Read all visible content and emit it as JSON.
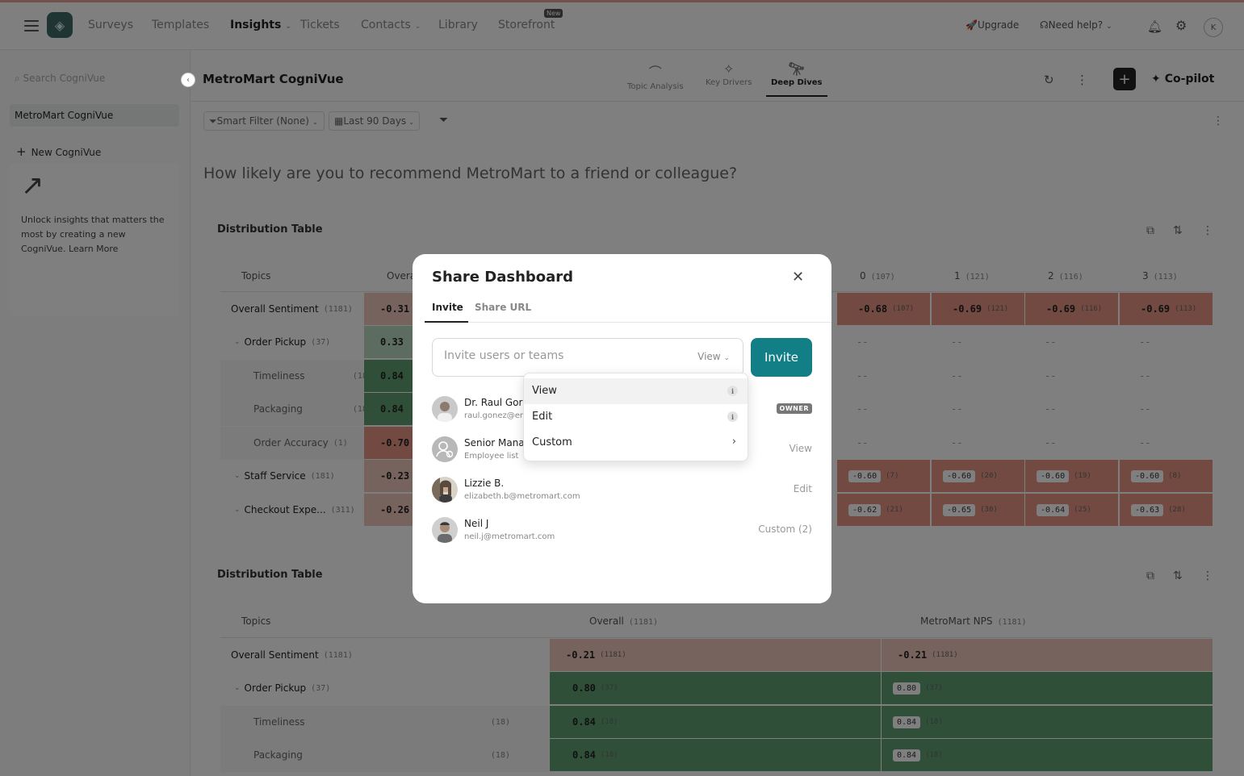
{
  "nav": {
    "items": [
      "Surveys",
      "Templates",
      "Insights",
      "Tickets",
      "Contacts",
      "Library",
      "Storefront"
    ],
    "new_badge": "New",
    "upgrade": "Upgrade",
    "help": "Need help?",
    "avatar_initial": "K"
  },
  "sidebar": {
    "search_placeholder": "Search CogniVue",
    "active_item": "MetroMart CogniVue",
    "new_item": "New CogniVue",
    "promo_text": "Unlock insights that matters the most by creating a new CogniVue.",
    "promo_link": "Learn More"
  },
  "header": {
    "title": "MetroMart CogniVue",
    "tabs": [
      "Topic Analysis",
      "Key Drivers",
      "Deep Dives"
    ],
    "active_tab": "Deep Dives",
    "copilot": "Co-pilot"
  },
  "filters": {
    "smart_filter": "Smart Filter (None)",
    "date_range": "Last 90 Days"
  },
  "question": "How likely are you to recommend MetroMart to a friend or colleague?",
  "table1": {
    "title": "Distribution Table",
    "col_topics": "Topics",
    "col_overall": "Overa",
    "score_cols": [
      {
        "label": "0",
        "count": "(107)"
      },
      {
        "label": "1",
        "count": "(121)"
      },
      {
        "label": "2",
        "count": "(116)"
      },
      {
        "label": "3",
        "count": "(113)"
      }
    ],
    "rows": [
      {
        "label": "Overall Sentiment",
        "count": "(1181)",
        "overall": "-0.31",
        "cells": [
          "-0.68",
          "-0.69",
          "-0.69",
          "-0.69"
        ],
        "subs": [
          "(107)",
          "(121)",
          "(116)",
          "(113)"
        ]
      },
      {
        "label": "Order Pickup",
        "count": "(37)",
        "overall": "0.33",
        "cells": [
          "--",
          "--",
          "--",
          "--"
        ],
        "subs": [
          "",
          "",
          "",
          ""
        ]
      },
      {
        "label": "Timeliness",
        "count": "(18)",
        "overall": "0.84",
        "cells": [
          "--",
          "--",
          "--",
          "--"
        ],
        "subs": [
          "",
          "",
          "",
          ""
        ]
      },
      {
        "label": "Packaging",
        "count": "(18)",
        "overall": "0.84",
        "cells": [
          "--",
          "--",
          "--",
          "--"
        ],
        "subs": [
          "",
          "",
          "",
          ""
        ]
      },
      {
        "label": "Order Accuracy",
        "count": "(1)",
        "overall": "-0.70",
        "cells": [
          "--",
          "--",
          "--",
          "--"
        ],
        "subs": [
          "",
          "",
          "",
          ""
        ]
      },
      {
        "label": "Staff Service",
        "count": "(181)",
        "overall": "-0.23",
        "cells": [
          "-0.60",
          "-0.60",
          "-0.60",
          "-0.60"
        ],
        "subs": [
          "(7)",
          "(20)",
          "(19)",
          "(8)"
        ]
      },
      {
        "label": "Checkout Expe...",
        "count": "(311)",
        "overall": "-0.26",
        "cells": [
          "-0.62",
          "-0.65",
          "-0.64",
          "-0.63"
        ],
        "subs": [
          "(21)",
          "(30)",
          "(25)",
          "(28)"
        ]
      }
    ]
  },
  "table2": {
    "title": "Distribution Table",
    "col_topics": "Topics",
    "col_overall": "Overall",
    "col_overall_count": "(1181)",
    "col_nps": "MetroMart NPS",
    "col_nps_count": "(1181)",
    "rows": [
      {
        "label": "Overall Sentiment",
        "count": "(1181)",
        "overall": "-0.21",
        "overall_sub": "(1181)",
        "nps": "-0.21",
        "nps_sub": "(1181)"
      },
      {
        "label": "Order Pickup",
        "count": "(37)",
        "overall": "0.80",
        "overall_sub": "(37)",
        "nps": "0.80",
        "nps_sub": "(37)"
      },
      {
        "label": "Timeliness",
        "count": "(18)",
        "overall": "0.84",
        "overall_sub": "(18)",
        "nps": "0.84",
        "nps_sub": "(18)"
      },
      {
        "label": "Packaging",
        "count": "(18)",
        "overall": "0.84",
        "overall_sub": "(18)",
        "nps": "0.84",
        "nps_sub": "(18)"
      }
    ]
  },
  "modal": {
    "title": "Share Dashboard",
    "tabs": [
      "Invite",
      "Share URL"
    ],
    "input_placeholder": "Invite users or teams",
    "input_permission": "View",
    "invite_button": "Invite",
    "users": [
      {
        "name": "Dr. Raul Gor",
        "email": "raul.gonez@er",
        "role": "OWNER"
      },
      {
        "name": "Senior Mana",
        "email": "Employee list",
        "role": "View"
      },
      {
        "name": "Lizzie B.",
        "email": "elizabeth.b@metromart.com",
        "role": "Edit"
      },
      {
        "name": "Neil J",
        "email": "neil.j@metromart.com",
        "role": "Custom (2)"
      }
    ]
  },
  "dropdown": {
    "items": [
      "View",
      "Edit",
      "Custom"
    ],
    "selected": "View",
    "info_glyph": "i"
  }
}
